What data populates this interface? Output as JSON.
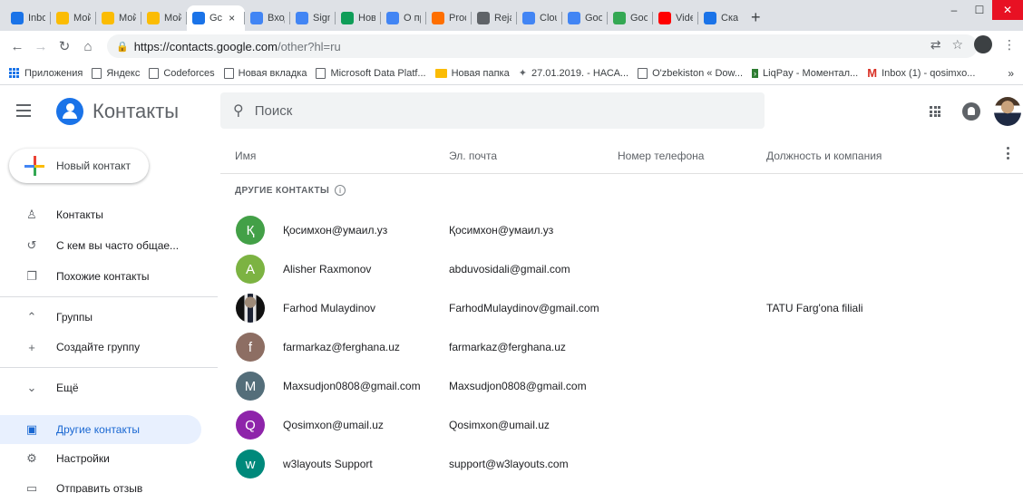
{
  "browser": {
    "tabs": [
      {
        "title": "Inbox",
        "favicon": "gmail-icon",
        "color": "#1a73e8",
        "active": false
      },
      {
        "title": "Мой д",
        "favicon": "drive-icon",
        "color": "#fbbc04",
        "active": false
      },
      {
        "title": "Мой д",
        "favicon": "drive-icon",
        "color": "#fbbc04",
        "active": false
      },
      {
        "title": "Мой д",
        "favicon": "drive-icon",
        "color": "#fbbc04",
        "active": false
      },
      {
        "title": "Gc",
        "favicon": "contacts-icon",
        "color": "#1a73e8",
        "active": true
      },
      {
        "title": "Вход",
        "favicon": "google-icon",
        "color": "#4285f4",
        "active": false
      },
      {
        "title": "Sign i",
        "favicon": "google-icon",
        "color": "#4285f4",
        "active": false
      },
      {
        "title": "Новая",
        "favicon": "plus-icon",
        "color": "#0f9d58",
        "active": false
      },
      {
        "title": "О про",
        "favicon": "google-icon",
        "color": "#4285f4",
        "active": false
      },
      {
        "title": "Produ",
        "favicon": "product-icon",
        "color": "#ff6f00",
        "active": false
      },
      {
        "title": "Rejala",
        "favicon": "rejala-icon",
        "color": "#5f6368",
        "active": false
      },
      {
        "title": "Cloud",
        "favicon": "cloud-icon",
        "color": "#4285f4",
        "active": false
      },
      {
        "title": "Googl",
        "favicon": "cloud-icon",
        "color": "#4285f4",
        "active": false
      },
      {
        "title": "Googl",
        "favicon": "sheets-icon",
        "color": "#34a853",
        "active": false
      },
      {
        "title": "Video",
        "favicon": "video-icon",
        "color": "#ff0000",
        "active": false
      },
      {
        "title": "Скача",
        "favicon": "download-icon",
        "color": "#1a73e8",
        "active": false
      }
    ],
    "tab_close": "×",
    "new_tab": "+",
    "url_host": "https://contacts.google.com",
    "url_path": "/other?hl=ru",
    "bookmarks": [
      {
        "label": "Приложения",
        "icon": "apps-icon"
      },
      {
        "label": "Яндекс",
        "icon": "page-icon"
      },
      {
        "label": "Codeforces",
        "icon": "page-icon"
      },
      {
        "label": "Новая вкладка",
        "icon": "page-icon"
      },
      {
        "label": "Microsoft Data Platf...",
        "icon": "page-icon"
      },
      {
        "label": "Новая папка",
        "icon": "folder-icon"
      },
      {
        "label": "27.01.2019. - НАСА...",
        "icon": "satellite-icon"
      },
      {
        "label": "O'zbekiston « Dow...",
        "icon": "page-icon"
      },
      {
        "label": "LiqPay - Моментал...",
        "icon": "liqpay-icon"
      },
      {
        "label": "Inbox (1) - qosimxo...",
        "icon": "gmail-icon"
      }
    ],
    "bookmarks_more": "»"
  },
  "app": {
    "title": "Контакты",
    "search_placeholder": "Поиск"
  },
  "sidebar": {
    "new_contact": "Новый контакт",
    "items": [
      {
        "label": "Контакты",
        "icon": "person-icon"
      },
      {
        "label": "С кем вы часто общае...",
        "icon": "history-icon"
      },
      {
        "label": "Похожие контакты",
        "icon": "copy-icon"
      },
      {
        "label": "Группы",
        "icon": "chevron-up-icon"
      },
      {
        "label": "Создайте группу",
        "icon": "plus-icon"
      },
      {
        "label": "Ещё",
        "icon": "chevron-down-icon"
      },
      {
        "label": "Другие контакты",
        "icon": "archive-icon"
      },
      {
        "label": "Настройки",
        "icon": "gear-icon"
      },
      {
        "label": "Отправить отзыв",
        "icon": "feedback-icon"
      }
    ]
  },
  "list": {
    "columns": {
      "name": "Имя",
      "email": "Эл. почта",
      "phone": "Номер телефона",
      "job": "Должность и компания"
    },
    "section_label": "ДРУГИЕ КОНТАКТЫ",
    "info_icon": "i",
    "contacts": [
      {
        "initial": "Қ",
        "name": "Қосимхон@умаил.уз",
        "email": "Қосимхон@умаил.уз",
        "phone": "",
        "company": "",
        "color": "#43a047"
      },
      {
        "initial": "A",
        "name": "Alisher Raxmonov",
        "email": "abduvosidali@gmail.com",
        "phone": "",
        "company": "",
        "color": "#7cb342"
      },
      {
        "initial": "",
        "name": "Farhod Mulaydinov",
        "email": "FarhodMulaydinov@gmail.com",
        "phone": "",
        "company": "TATU Farg'ona filiali",
        "color": "#212121",
        "photo": true
      },
      {
        "initial": "f",
        "name": "farmarkaz@ferghana.uz",
        "email": "farmarkaz@ferghana.uz",
        "phone": "",
        "company": "",
        "color": "#8d6e63"
      },
      {
        "initial": "M",
        "name": "Maxsudjon0808@gmail.com",
        "email": "Maxsudjon0808@gmail.com",
        "phone": "",
        "company": "",
        "color": "#546e7a"
      },
      {
        "initial": "Q",
        "name": "Qosimxon@umail.uz",
        "email": "Qosimxon@umail.uz",
        "phone": "",
        "company": "",
        "color": "#8e24aa"
      },
      {
        "initial": "w",
        "name": "w3layouts Support",
        "email": "support@w3layouts.com",
        "phone": "",
        "company": "",
        "color": "#00897b"
      }
    ]
  }
}
